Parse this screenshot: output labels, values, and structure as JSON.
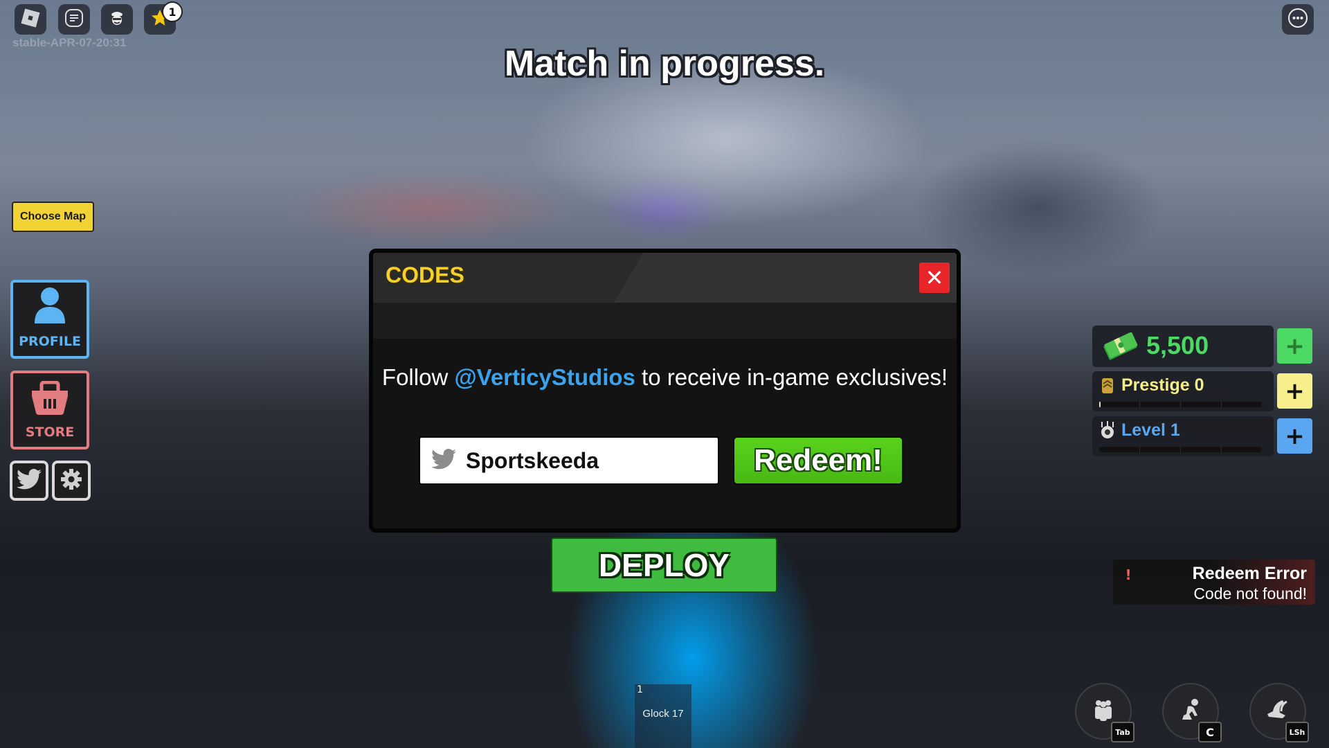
{
  "topbar": {
    "build_label": "stable-APR-07-20:31",
    "buttons": [
      {
        "icon": "roblox-logo-icon"
      },
      {
        "icon": "chat-icon"
      },
      {
        "icon": "character-icon"
      },
      {
        "icon": "star-icon",
        "badge": "1"
      }
    ],
    "menu_icon": "more-icon"
  },
  "status_title": "Match in progress.",
  "left": {
    "choose_map_label": "Choose Map",
    "profile_label": "PROFILE",
    "store_label": "STORE",
    "twitter_icon": "twitter-icon",
    "settings_icon": "gear-icon"
  },
  "codes_dialog": {
    "title": "CODES",
    "close_label": "✕",
    "message_prefix": "Follow ",
    "message_handle": "@VerticyStudios",
    "message_suffix": " to receive in-game exclusives!",
    "code_input_value": "Sportskeeda",
    "redeem_label": "Redeem!"
  },
  "deploy_label": "DEPLOY",
  "stats": {
    "cash": {
      "value": "5,500",
      "color": "#4cd964"
    },
    "prestige": {
      "label": "Prestige 0",
      "progress": 0.01,
      "color": "#f5ec8a"
    },
    "level": {
      "label": "Level 1",
      "progress": 0,
      "color": "#5aa6f0"
    },
    "plus_label": "+"
  },
  "toast": {
    "icon": "!",
    "title": "Redeem Error",
    "message": "Code not found!"
  },
  "hotbar": {
    "slot_number": "1",
    "slot_name": "Glock 17"
  },
  "actions": [
    {
      "icon": "players-icon",
      "key": "Tab"
    },
    {
      "icon": "crouch-icon",
      "key": "C"
    },
    {
      "icon": "sprint-icon",
      "key": "LSh"
    }
  ]
}
